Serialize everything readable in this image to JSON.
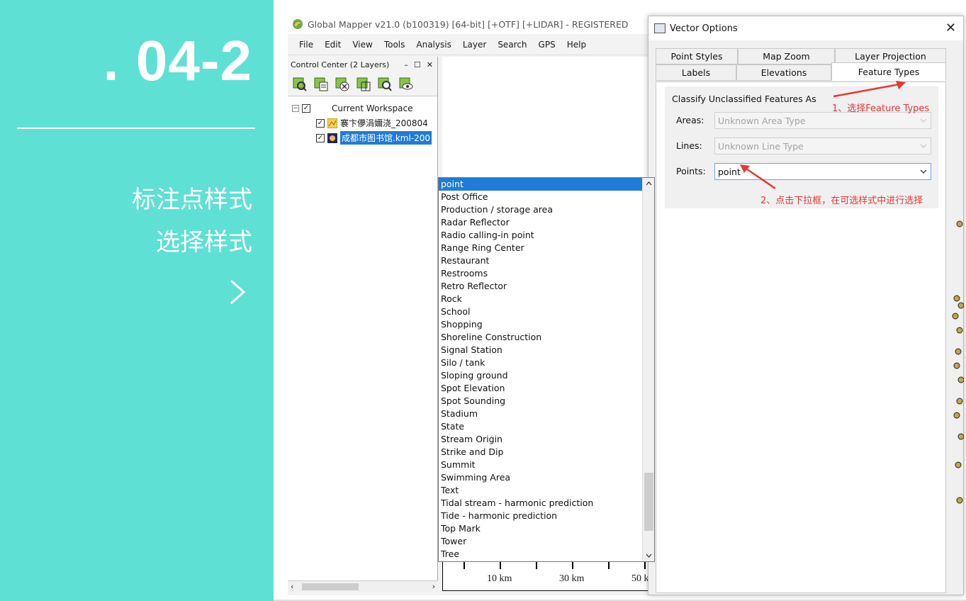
{
  "slide": {
    "number": ". 04-2",
    "subtitle_1": "标注点样式",
    "subtitle_2": "选择样式"
  },
  "app": {
    "title": "Global Mapper v21.0 (b100319) [64-bit] [+OTF] [+LIDAR] - REGISTERED",
    "menu": [
      "File",
      "Edit",
      "View",
      "Tools",
      "Analysis",
      "Layer",
      "Search",
      "GPS",
      "Help"
    ]
  },
  "control_center": {
    "title": "Control Center (2 Layers)",
    "workspace": "Current Workspace",
    "layers": [
      "褰卞儚涓嬭浇_200804",
      "成都市图书馆.kml-200"
    ]
  },
  "scalebar": {
    "labels": [
      "10 km",
      "30 km",
      "50 k"
    ]
  },
  "dialog": {
    "title": "Vector Options",
    "tabs_row1": [
      "Point Styles",
      "Map Zoom",
      "Layer Projection"
    ],
    "tabs_row2": [
      "Labels",
      "Elevations",
      "Feature Types"
    ],
    "group_title": "Classify Unclassified Features As",
    "areas_label": "Areas:",
    "areas_value": "Unknown Area Type",
    "lines_label": "Lines:",
    "lines_value": "Unknown Line Type",
    "points_label": "Points:",
    "points_value": "point",
    "options": [
      "point",
      "Post Office",
      "Production / storage area",
      "Radar Reflector",
      "Radio calling-in point",
      "Range Ring Center",
      "Restaurant",
      "Restrooms",
      "Retro Reflector",
      "Rock",
      "School",
      "Shopping",
      "Shoreline Construction",
      "Signal Station",
      "Silo / tank",
      "Sloping ground",
      "Spot Elevation",
      "Spot Sounding",
      "Stadium",
      "State",
      "Stream Origin",
      "Strike and Dip",
      "Summit",
      "Swimming Area",
      "Text",
      "Tidal stream - harmonic prediction",
      "Tide - harmonic prediction",
      "Top Mark",
      "Tower",
      "Tree"
    ]
  },
  "annotations": {
    "step1": "1、选择Feature Types",
    "step2": "2、点击下拉框，在可选样式中进行选择"
  },
  "colors": {
    "teal": "#5fe0d4",
    "selection": "#1f7bd6",
    "annotation": "#e53935"
  }
}
